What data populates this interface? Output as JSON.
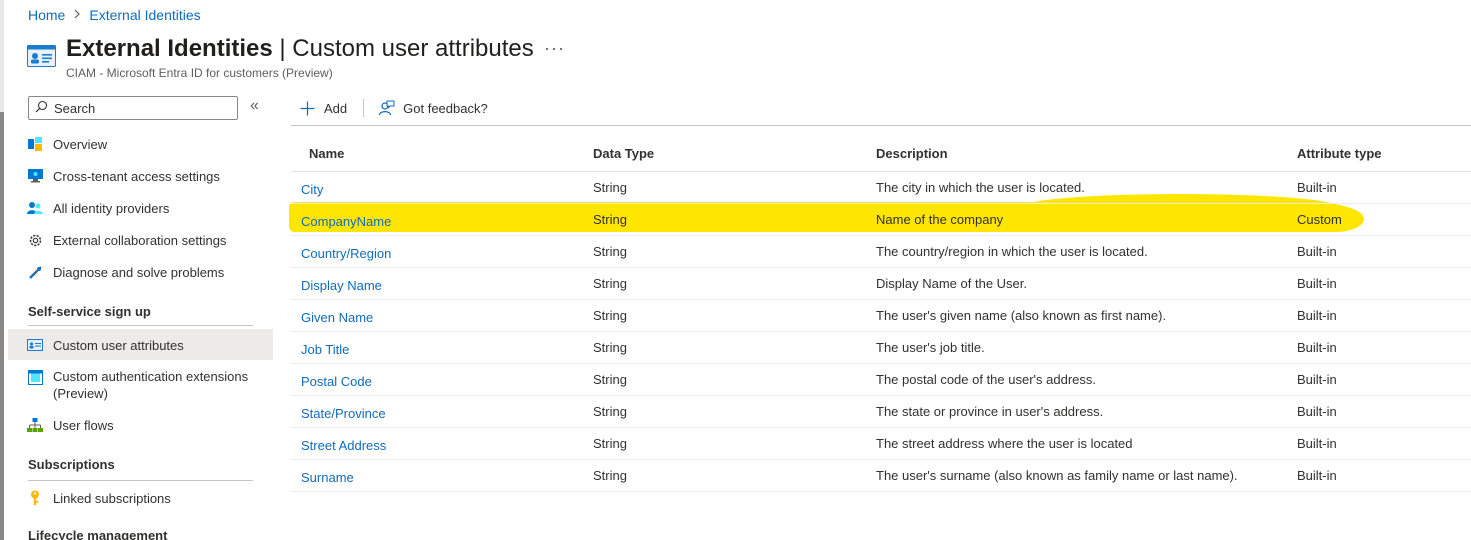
{
  "breadcrumb": {
    "home": "Home",
    "separator": ">",
    "current": "External Identities"
  },
  "header": {
    "title_bold": "External Identities",
    "title_rest": " | Custom user attributes",
    "more": "···",
    "subtitle": "CIAM - Microsoft Entra ID for customers (Preview)"
  },
  "sidebar": {
    "search_placeholder": "Search",
    "collapse": "«",
    "items": [
      {
        "label": "Overview",
        "icon": "overview-icon"
      },
      {
        "label": "Cross-tenant access settings",
        "icon": "monitor-icon"
      },
      {
        "label": "All identity providers",
        "icon": "users-icon"
      },
      {
        "label": "External collaboration settings",
        "icon": "gear-icon"
      },
      {
        "label": "Diagnose and solve problems",
        "icon": "wrench-icon"
      }
    ],
    "section1": "Self-service sign up",
    "section1_items": [
      {
        "label": "Custom user attributes",
        "icon": "id-card-icon",
        "active": true
      },
      {
        "label": "Custom authentication extensions",
        "label2": "(Preview)",
        "icon": "extension-icon"
      },
      {
        "label": "User flows",
        "icon": "flow-icon"
      }
    ],
    "section2": "Subscriptions",
    "section2_items": [
      {
        "label": "Linked subscriptions",
        "icon": "key-icon"
      }
    ],
    "section3": "Lifecycle management"
  },
  "toolbar": {
    "add_label": "Add",
    "feedback_label": "Got feedback?"
  },
  "table": {
    "headers": [
      "Name",
      "Data Type",
      "Description",
      "Attribute type"
    ],
    "rows": [
      {
        "name": "City",
        "type": "String",
        "desc": "The city in which the user is located.",
        "attr": "Built-in"
      },
      {
        "name": "CompanyName",
        "type": "String",
        "desc": "Name of the company",
        "attr": "Custom"
      },
      {
        "name": "Country/Region",
        "type": "String",
        "desc": "The country/region in which the user is located.",
        "attr": "Built-in"
      },
      {
        "name": "Display Name",
        "type": "String",
        "desc": "Display Name of the User.",
        "attr": "Built-in"
      },
      {
        "name": "Given Name",
        "type": "String",
        "desc": "The user's given name (also known as first name).",
        "attr": "Built-in"
      },
      {
        "name": "Job Title",
        "type": "String",
        "desc": "The user's job title.",
        "attr": "Built-in"
      },
      {
        "name": "Postal Code",
        "type": "String",
        "desc": "The postal code of the user's address.",
        "attr": "Built-in"
      },
      {
        "name": "State/Province",
        "type": "String",
        "desc": "The state or province in user's address.",
        "attr": "Built-in"
      },
      {
        "name": "Street Address",
        "type": "String",
        "desc": "The street address where the user is located",
        "attr": "Built-in"
      },
      {
        "name": "Surname",
        "type": "String",
        "desc": "The user's surname (also known as family name or last name).",
        "attr": "Built-in"
      }
    ]
  },
  "colors": {
    "link": "#0f6cbd",
    "highlight": "#ffe600",
    "active_bg": "#edebe9"
  }
}
